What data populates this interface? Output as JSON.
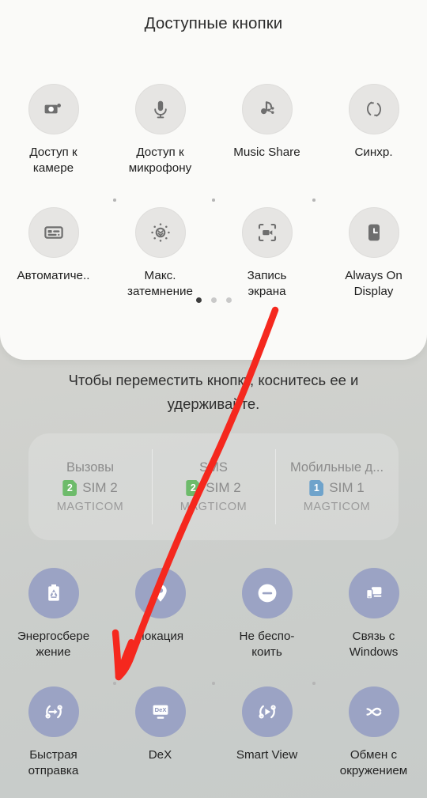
{
  "sheet": {
    "title": "Доступные кнопки",
    "page_indicator": {
      "count": 3,
      "active_index": 0
    },
    "buttons": [
      {
        "icon": "camera-icon",
        "label": "Доступ к\nкамере"
      },
      {
        "icon": "microphone-icon",
        "label": "Доступ к\nмикрофону"
      },
      {
        "icon": "music-share-icon",
        "label": "Music Share"
      },
      {
        "icon": "sync-icon",
        "label": "Синхр."
      },
      {
        "icon": "captions-icon",
        "label": "Автоматиче.."
      },
      {
        "icon": "extra-dim-icon",
        "label": "Макс.\nзатемнение"
      },
      {
        "icon": "screen-record-icon",
        "label": "Запись\nэкрана"
      },
      {
        "icon": "always-on-display-icon",
        "label": "Always On\nDisplay"
      }
    ]
  },
  "hint": "Чтобы переместить кнопку, коснитесь ее и удерживайте.",
  "sim_panel": [
    {
      "title": "Вызовы",
      "badge": "2",
      "badge_color": "#6dbb6a",
      "slot": "SIM 2",
      "operator": "MAGTICOM"
    },
    {
      "title": "SMS",
      "badge": "2",
      "badge_color": "#6dbb6a",
      "slot": "SIM 2",
      "operator": "MAGTICOM"
    },
    {
      "title": "Мобильные д...",
      "badge": "1",
      "badge_color": "#6fa3cb",
      "slot": "SIM 1",
      "operator": "MAGTICOM"
    }
  ],
  "quick_panel": {
    "accent_color": "#9ba3c4",
    "row1": [
      {
        "icon": "battery-saver-icon",
        "label": "Энергосбере\nжение"
      },
      {
        "icon": "location-pin-icon",
        "label": "Локация"
      },
      {
        "icon": "do-not-disturb-icon",
        "label": "Не беспо-\nкоить"
      },
      {
        "icon": "link-to-windows-icon",
        "label": "Связь с\nWindows"
      }
    ],
    "row2": [
      {
        "icon": "quick-share-icon",
        "label": "Быстрая\nотправка"
      },
      {
        "icon": "dex-icon",
        "label": "DeX",
        "icon_text": "DeX"
      },
      {
        "icon": "smart-view-icon",
        "label": "Smart View"
      },
      {
        "icon": "nearby-share-icon",
        "label": "Обмен с\nокружением"
      }
    ]
  },
  "annotation": {
    "type": "hand-drawn-arrow",
    "color": "#f5281e"
  }
}
